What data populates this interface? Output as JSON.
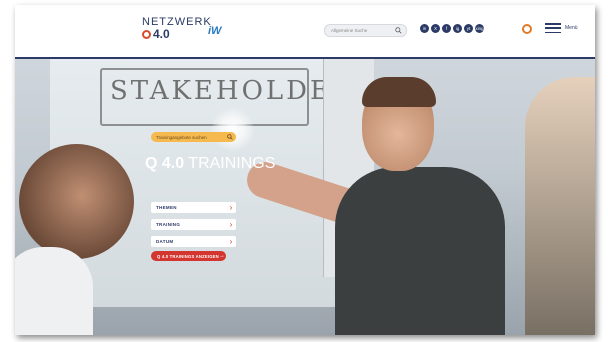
{
  "header": {
    "logo_top": "NETZWERK",
    "logo_bottom": "4.0",
    "partner_logo": "iW",
    "search_placeholder": "Allgemeine Suche",
    "social_icons": [
      "in",
      "X",
      "f",
      "ig",
      "yt",
      "xing"
    ],
    "menu_label": "Menü"
  },
  "hero": {
    "title_bold": "Q 4.0",
    "title_rest": "TRAININGS",
    "whiteboard_text": "STAKEHOLDER",
    "search_placeholder": "Trainingangebote suchen",
    "filters": [
      "THEMEN",
      "TRAINING",
      "DATUM"
    ],
    "cta_label": "Q 4.0 TRAININGS ANZEIGEN"
  },
  "colors": {
    "navy": "#2b3a66",
    "accent_red": "#d3362e",
    "search_orange": "#f5b94d"
  }
}
